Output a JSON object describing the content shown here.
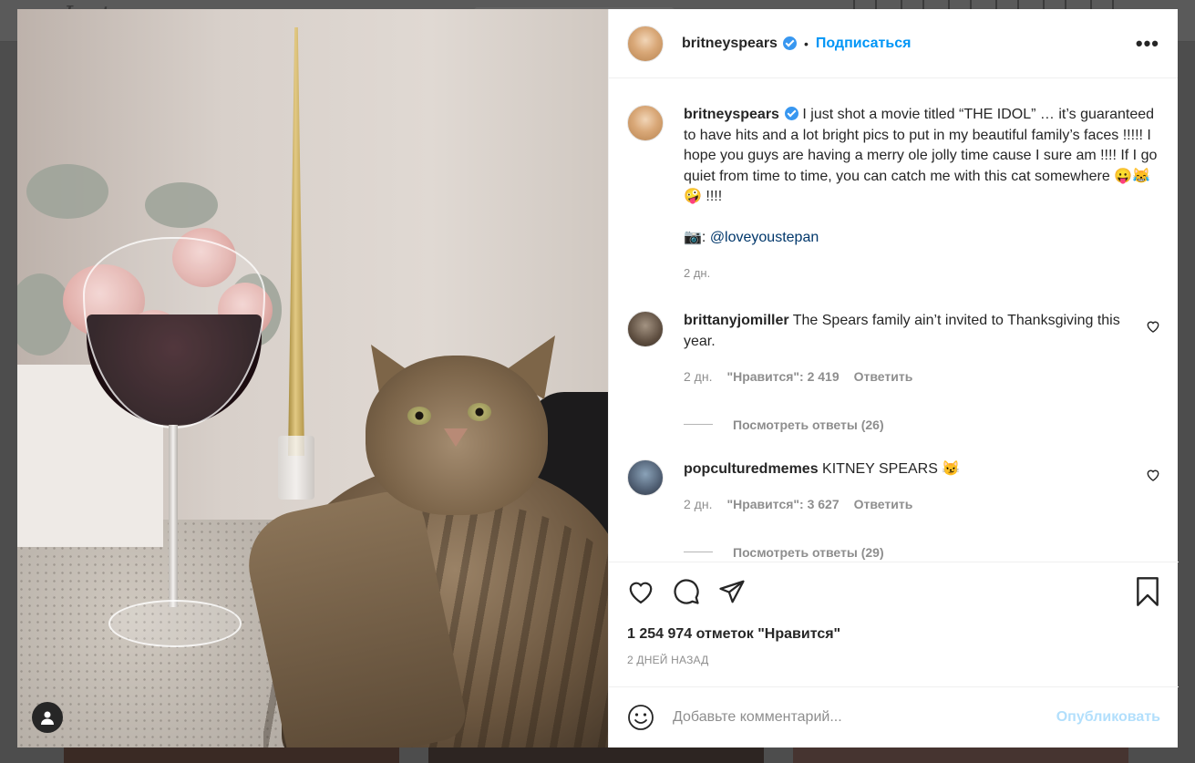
{
  "background_page": {
    "logo_text": "Instagram"
  },
  "post": {
    "author": "britneyspears",
    "follow_label": "Подписаться",
    "separator": "•",
    "more_label": "•••",
    "caption": {
      "text": "I just shot a movie titled “THE IDOL” … it’s guaranteed to have hits and a lot bright pics to put in my beautiful family’s faces !!!!! I hope you guys are having a merry ole jolly time cause I sure am !!!! If I go quiet from time to time, you can catch me with this cat somewhere 😛😹🤪 !!!!",
      "credit_prefix": "📷: ",
      "credit_mention": "@loveyoustepan",
      "time": "2 дн."
    },
    "comments": [
      {
        "user": "brittanyjomiller",
        "text": "The Spears family ain’t invited to Thanksgiving this year.",
        "time": "2 дн.",
        "likes": "\"Нравится\": 2 419",
        "reply_label": "Ответить",
        "view_replies": "Посмотреть ответы (26)"
      },
      {
        "user": "popculturedmemes",
        "text": "KITNEY SPEARS 😼",
        "time": "2 дн.",
        "likes": "\"Нравится\": 3 627",
        "reply_label": "Ответить",
        "view_replies": "Посмотреть ответы (29)"
      }
    ],
    "likes_count": "1 254 974 отметок \"Нравится\"",
    "date": "2 ДНЕЙ НАЗАД",
    "comment_placeholder": "Добавьте комментарий...",
    "publish_label": "Опубликовать",
    "colors": {
      "accent": "#0095f6",
      "publish_disabled": "#b2dffc",
      "verified": "#3897f0",
      "secondary_text": "#8e8e8e"
    },
    "icons": [
      "heart-icon",
      "comment-icon",
      "share-icon",
      "bookmark-icon",
      "emoji-icon",
      "user-tag-icon",
      "verified-badge-icon"
    ]
  }
}
